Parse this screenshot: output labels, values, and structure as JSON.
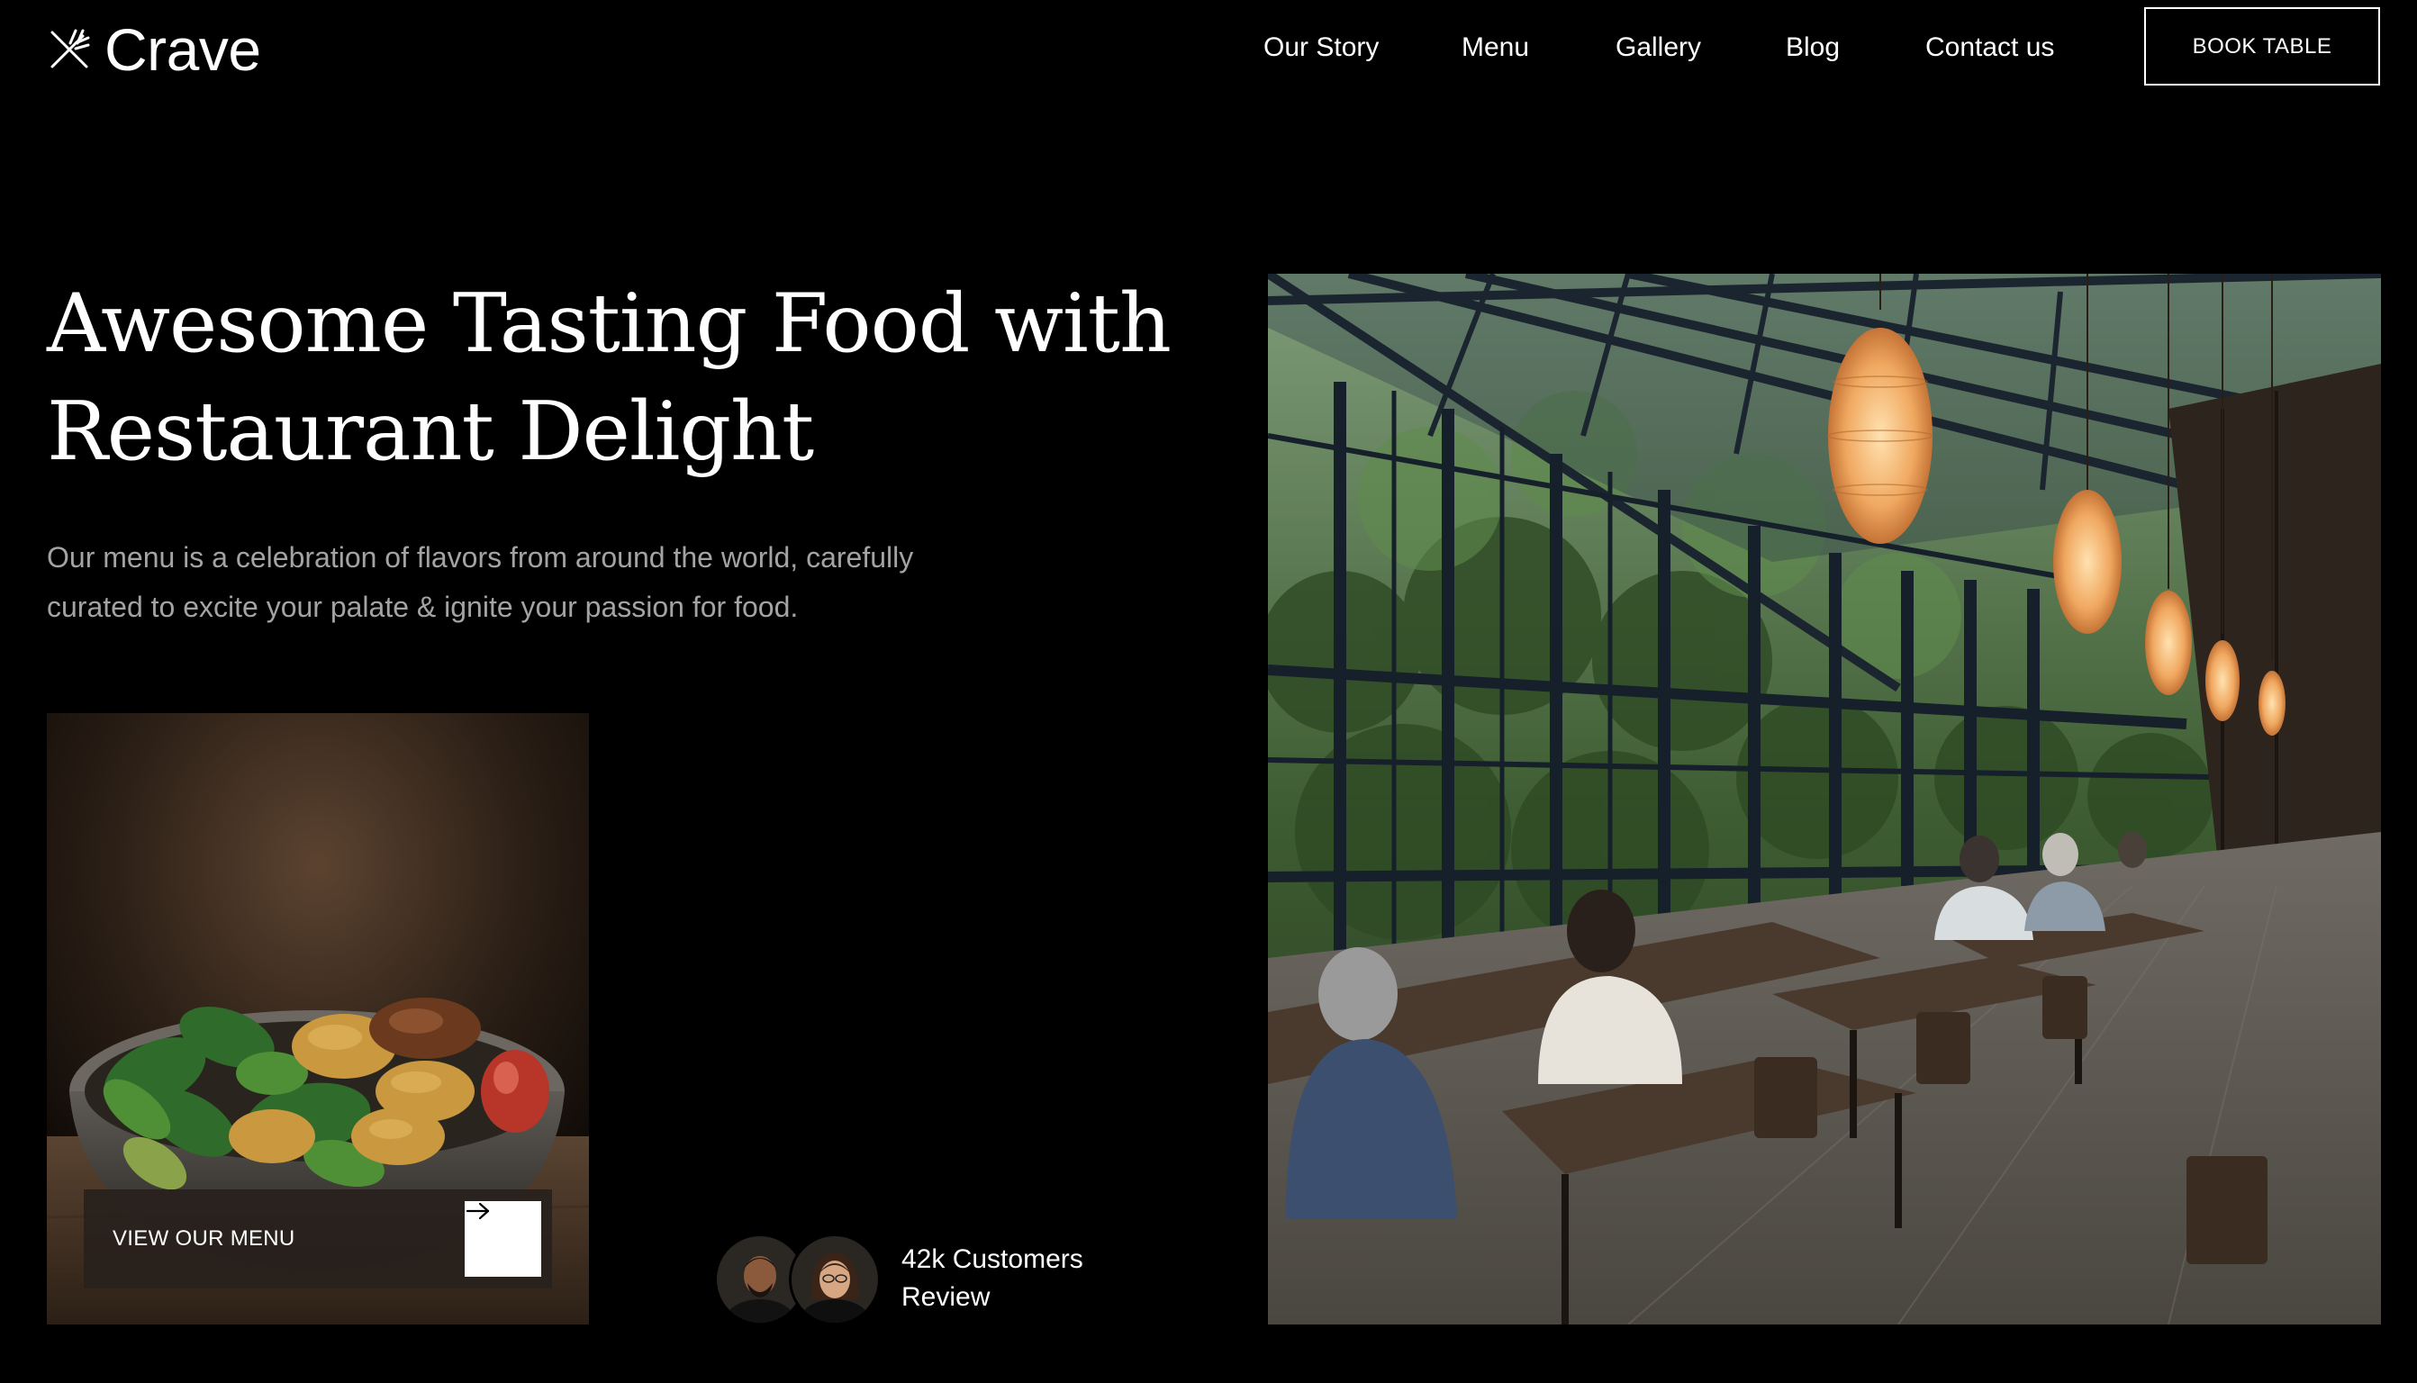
{
  "brand": {
    "name": "Crave",
    "logo_icon": "fork-knife-icon"
  },
  "nav": {
    "items": [
      "Our Story",
      "Menu",
      "Gallery",
      "Blog",
      "Contact us"
    ],
    "cta": "BOOK TABLE"
  },
  "hero": {
    "title_line1": "Awesome Tasting Food with",
    "title_line2": "Restaurant Delight",
    "subtitle_line1": "Our menu is a celebration of flavors from around the world, carefully",
    "subtitle_line2": "curated to excite your palate & ignite your passion for food."
  },
  "menu_card": {
    "button_label": "VIEW OUR MENU",
    "arrow_icon": "arrow-right-icon",
    "image": "food-bowl-photo"
  },
  "reviews": {
    "line1": "42k Customers",
    "line2": "Review",
    "avatars": [
      "customer-avatar-man",
      "customer-avatar-woman"
    ]
  },
  "gallery": {
    "image": "restaurant-interior-photo"
  },
  "colors": {
    "background": "#000000",
    "text": "#ffffff",
    "muted_text": "#a3a3a3",
    "button_panel": "#28211c"
  }
}
